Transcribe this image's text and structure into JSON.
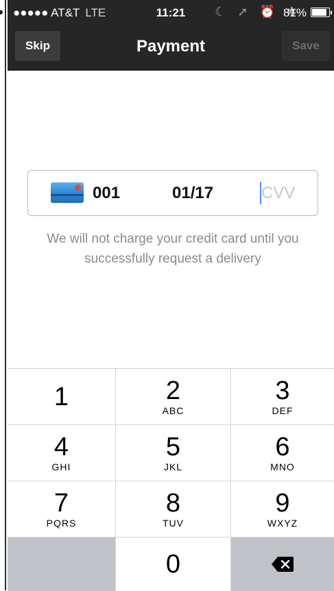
{
  "status_bar": {
    "carrier": "●●●●● AT&T",
    "network": "LTE",
    "time": "11:21",
    "icons": "☾ ➚ ⏰ ✱",
    "battery": "81%"
  },
  "nav": {
    "skip_label": "Skip",
    "title": "Payment",
    "save_label": "Save"
  },
  "card": {
    "icon": "credit-card-icon",
    "number": "001",
    "expiry": "01/17",
    "cvv_placeholder": "CVV"
  },
  "notice": "We will not charge your credit card until you successfully request a delivery",
  "keypad": {
    "keys": [
      {
        "digit": "1",
        "letters": ""
      },
      {
        "digit": "2",
        "letters": "ABC"
      },
      {
        "digit": "3",
        "letters": "DEF"
      },
      {
        "digit": "4",
        "letters": "GHI"
      },
      {
        "digit": "5",
        "letters": "JKL"
      },
      {
        "digit": "6",
        "letters": "MNO"
      },
      {
        "digit": "7",
        "letters": "PQRS"
      },
      {
        "digit": "8",
        "letters": "TUV"
      },
      {
        "digit": "9",
        "letters": "WXYZ"
      },
      {
        "digit": "0",
        "letters": ""
      }
    ],
    "delete_icon": "backspace-icon"
  },
  "colors": {
    "nav_bg": "#262626",
    "cursor": "#4d90fe",
    "keypad_dark": "#bfc2c7",
    "notice_text": "#8a8a8a"
  }
}
